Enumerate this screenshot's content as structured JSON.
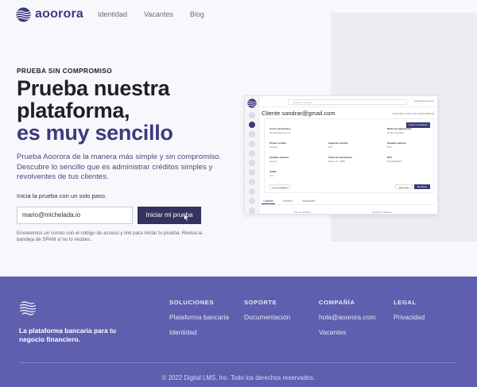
{
  "brand": {
    "name": "aoorora"
  },
  "nav": {
    "links": [
      "Identidad",
      "Vacantes",
      "Blog"
    ]
  },
  "hero": {
    "eyebrow": "PRUEBA SIN COMPROMISO",
    "headline_line1": "Prueba nuestra",
    "headline_line2": "plataforma,",
    "headline_accent": "es muy sencillo",
    "description": "Prueba Aoorora de la manera más simple y sin compromiso. Descubre lo sencillo que es administrar créditos simples y revolventes de tus clientes.",
    "cta_label": "Inicia la prueba con un solo paso.",
    "email_value": "mario@michelada.io",
    "cta_button": "Iniciar mi prueba",
    "note": "Enviaremos un correo con el código de acceso y link para iniciar tu prueba. Revisa la bandeja de SPAM si no lo recibes."
  },
  "mockup": {
    "search_placeholder": "Buscar un cliente...",
    "user": "sandrar@mail.com",
    "title": "Cliente sandrar@gmail.com",
    "subtitle": "CLIENTE/ID 5 ARU-SNA-HAGAN-PENDIE",
    "card_button": "Crear movimiento",
    "fields": [
      {
        "label": "Correo electrónico",
        "value": "sandrar@gmail.com"
      },
      {
        "label": "Medio de adquisición",
        "value": "Redes Sociales"
      },
      {
        "label": "Primer nombre",
        "value": "Sandra"
      },
      {
        "label": "Segundo nombre",
        "value": "N/A"
      },
      {
        "label": "Apellido paterno",
        "value": "Ruiz"
      },
      {
        "label": "Apellido materno",
        "value": "García"
      },
      {
        "label": "Fecha de nacimiento",
        "value": "Marzo 07, 1988"
      },
      {
        "label": "RFC",
        "value": "RUGS880307"
      },
      {
        "label": "CURP",
        "value": "N/A"
      }
    ],
    "more_button": "Ver metadatos",
    "back_button": "Regresar",
    "edit_button": "Modificar",
    "tabs": [
      "Cuentas",
      "Eventos",
      "Solicitudes"
    ],
    "table_headers": [
      "Tipo de archivo",
      "Fecha de creación"
    ]
  },
  "footer": {
    "tagline": "La plataforma bancaria para tu negocio financiero.",
    "columns": [
      {
        "title": "SOLUCIONES",
        "links": [
          "Plataforma bancaria",
          "Identidad"
        ]
      },
      {
        "title": "SOPORTE",
        "links": [
          "Documentación"
        ]
      },
      {
        "title": "COMPAÑÍA",
        "links": [
          "hola@aoorora.com",
          "Vacantes"
        ]
      },
      {
        "title": "LEGAL",
        "links": [
          "Privacidad"
        ]
      }
    ],
    "copyright": "© 2022 Digital LMS, Inc. Todo los derechos reservados."
  },
  "colors": {
    "brand": "#3c3a82",
    "button": "#34335f",
    "footer": "#5f5faf"
  }
}
